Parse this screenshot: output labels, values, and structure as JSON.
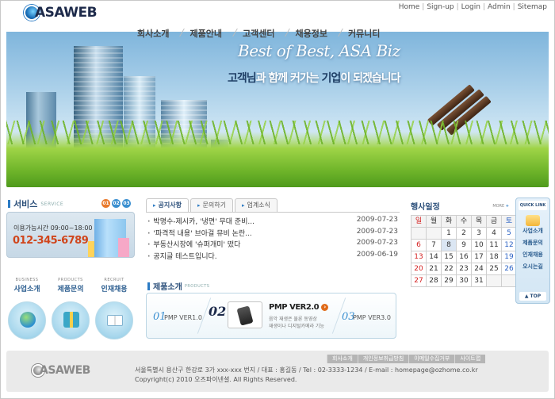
{
  "logo": {
    "text": "ASAWEB"
  },
  "topnav": [
    "Home",
    "Sign-up",
    "Login",
    "Admin",
    "Sitemap"
  ],
  "mainnav": [
    "회사소개",
    "제품안내",
    "고객센터",
    "채용정보",
    "커뮤니티"
  ],
  "hero": {
    "title": "Best of Best, ASA Biz",
    "sub_a": "고객님",
    "sub_b": "과 함께 커가는 ",
    "sub_c": "기업",
    "sub_d": "이 되겠습니다"
  },
  "service": {
    "title": "서비스",
    "title_en": "SERVICE",
    "nums": [
      "01",
      "02",
      "03"
    ],
    "hours": "이용가능시간 09:00~18:00",
    "tel": "012-345-6789",
    "quick": [
      {
        "en": "BUSINESS",
        "ko": "사업소개"
      },
      {
        "en": "PRODUCTS",
        "ko": "제품문의"
      },
      {
        "en": "RECRUIT",
        "ko": "인재채용"
      }
    ]
  },
  "news": {
    "tabs": [
      "공지사항",
      "문의하기",
      "업계소식"
    ],
    "items": [
      {
        "title": "박명수-제시카, '냉면' 무대 준비...",
        "date": "2009-07-23"
      },
      {
        "title": "'파격적 내용' 브아걸 뮤비 논란...",
        "date": "2009-07-23"
      },
      {
        "title": "부동산시장에 '슈퍼개미' 떴다",
        "date": "2009-07-23"
      },
      {
        "title": "공지글 테스트입니다.",
        "date": "2009-06-19"
      }
    ]
  },
  "products": {
    "title": "제품소개",
    "title_en": "PRODUCTS",
    "items": [
      {
        "num": "01",
        "name": "PMP VER1.0"
      },
      {
        "num": "02",
        "name": "PMP VER2.0"
      },
      {
        "num": "03",
        "name": "PMP VER3.0"
      }
    ],
    "desc1": "음악 재생은 물론 동영상",
    "desc2": "재생이나 디지털카메라 기능"
  },
  "calendar": {
    "title": "행사일정",
    "more": "MORE",
    "days": [
      "일",
      "월",
      "화",
      "수",
      "목",
      "금",
      "토"
    ],
    "weeks": [
      [
        "",
        "",
        "1",
        "2",
        "3",
        "4",
        "5"
      ],
      [
        "6",
        "7",
        "8",
        "9",
        "10",
        "11",
        "12"
      ],
      [
        "13",
        "14",
        "15",
        "16",
        "17",
        "18",
        "19"
      ],
      [
        "20",
        "21",
        "22",
        "23",
        "24",
        "25",
        "26"
      ],
      [
        "27",
        "28",
        "29",
        "30",
        "31",
        "",
        ""
      ]
    ]
  },
  "quicklink": {
    "title": "QUICK LINK",
    "items": [
      "사업소개",
      "제품문의",
      "인재채용",
      "오시는길"
    ],
    "top": "▲ TOP"
  },
  "footer": {
    "links": [
      "회사소개",
      "개인정보취급방침",
      "이메일수집거부",
      "사이트맵"
    ],
    "logo": "ASAWEB",
    "address": "서울특별시 용산구 한강로 3가 xxx-xxx 번지 / 대표 : 홍길동 / Tel : 02-3333-1234 / E-mail : homepage@ozhome.co.kr",
    "copyright": "Copyright(c) 2010 오즈파이넨셜. All Rights Reserved."
  }
}
